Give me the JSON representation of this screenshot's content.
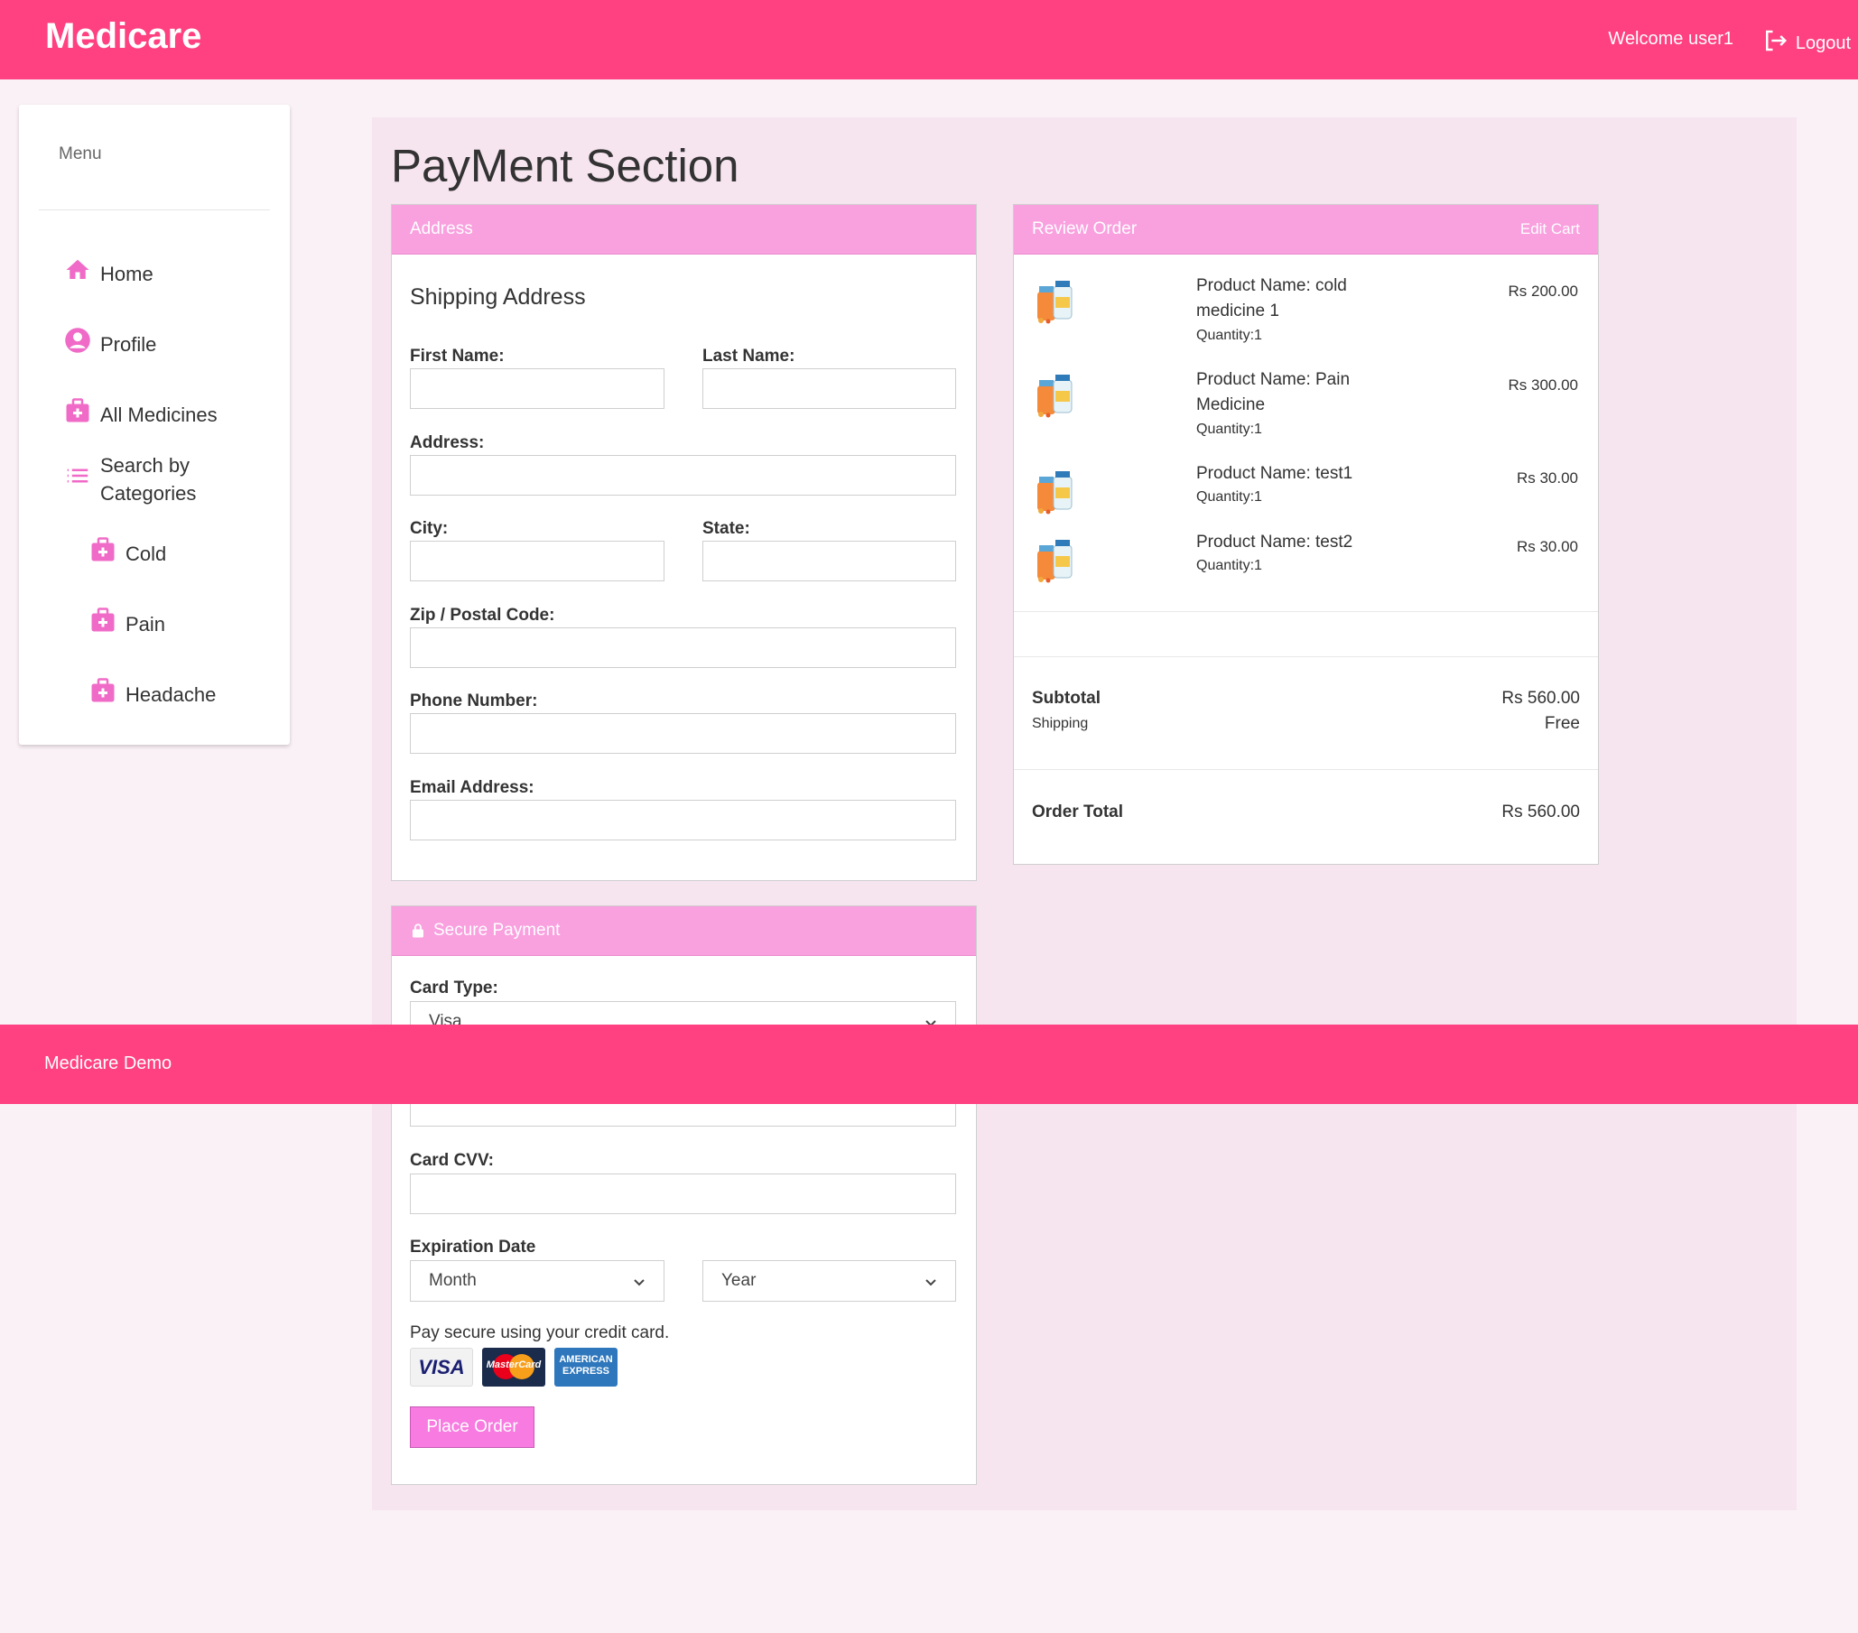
{
  "header": {
    "brand": "Medicare",
    "welcome": "Welcome user1",
    "logout_label": "Logout"
  },
  "sidebar": {
    "title": "Menu",
    "items": [
      {
        "label": "Home",
        "icon": "home-icon"
      },
      {
        "label": "Profile",
        "icon": "account-circle-icon"
      },
      {
        "label": "All Medicines",
        "icon": "medical-bag-icon"
      },
      {
        "label": "Search by Categories",
        "icon": "list-icon"
      },
      {
        "label": "Cold",
        "icon": "medical-bag-icon"
      },
      {
        "label": "Pain",
        "icon": "medical-bag-icon"
      },
      {
        "label": "Headache",
        "icon": "medical-bag-icon"
      }
    ]
  },
  "main": {
    "page_title": "PayMent Section"
  },
  "address_card": {
    "header": "Address",
    "section_title": "Shipping Address",
    "fields": {
      "first_name": "First Name:",
      "last_name": "Last Name:",
      "address": "Address:",
      "city": "City:",
      "state": "State:",
      "zip": "Zip / Postal Code:",
      "phone": "Phone Number:",
      "email": "Email Address:"
    }
  },
  "review_card": {
    "header": "Review Order",
    "edit_cart": "Edit Cart",
    "items": [
      {
        "name": "Product Name: cold medicine 1",
        "qty": "Quantity:1",
        "price": "Rs 200.00"
      },
      {
        "name": "Product Name: Pain Medicine",
        "qty": "Quantity:1",
        "price": "Rs 300.00"
      },
      {
        "name": "Product Name: test1",
        "qty": "Quantity:1",
        "price": "Rs 30.00"
      },
      {
        "name": "Product Name: test2",
        "qty": "Quantity:1",
        "price": "Rs 30.00"
      }
    ],
    "subtotal_label": "Subtotal",
    "subtotal_value": "Rs 560.00",
    "shipping_label": "Shipping",
    "shipping_value": "Free",
    "total_label": "Order Total",
    "total_value": "Rs 560.00"
  },
  "payment_card": {
    "header": "Secure Payment",
    "card_type_label": "Card Type:",
    "card_type_value": "Visa",
    "cvv_label": "Card CVV:",
    "expiration_label": "Expiration Date",
    "month_value": "Month",
    "year_value": "Year",
    "note": "Pay secure using your credit card.",
    "logos": {
      "visa": "VISA",
      "mastercard": "MasterCard",
      "amex_line1": "AMERICAN",
      "amex_line2": "EXPRESS"
    },
    "place_order": "Place Order"
  },
  "footer": {
    "text": "Medicare Demo"
  },
  "colors": {
    "primary": "#ff4081",
    "card_header": "#f9a0df",
    "content_bg": "#f6e4ef",
    "icon": "#f06bc7"
  }
}
